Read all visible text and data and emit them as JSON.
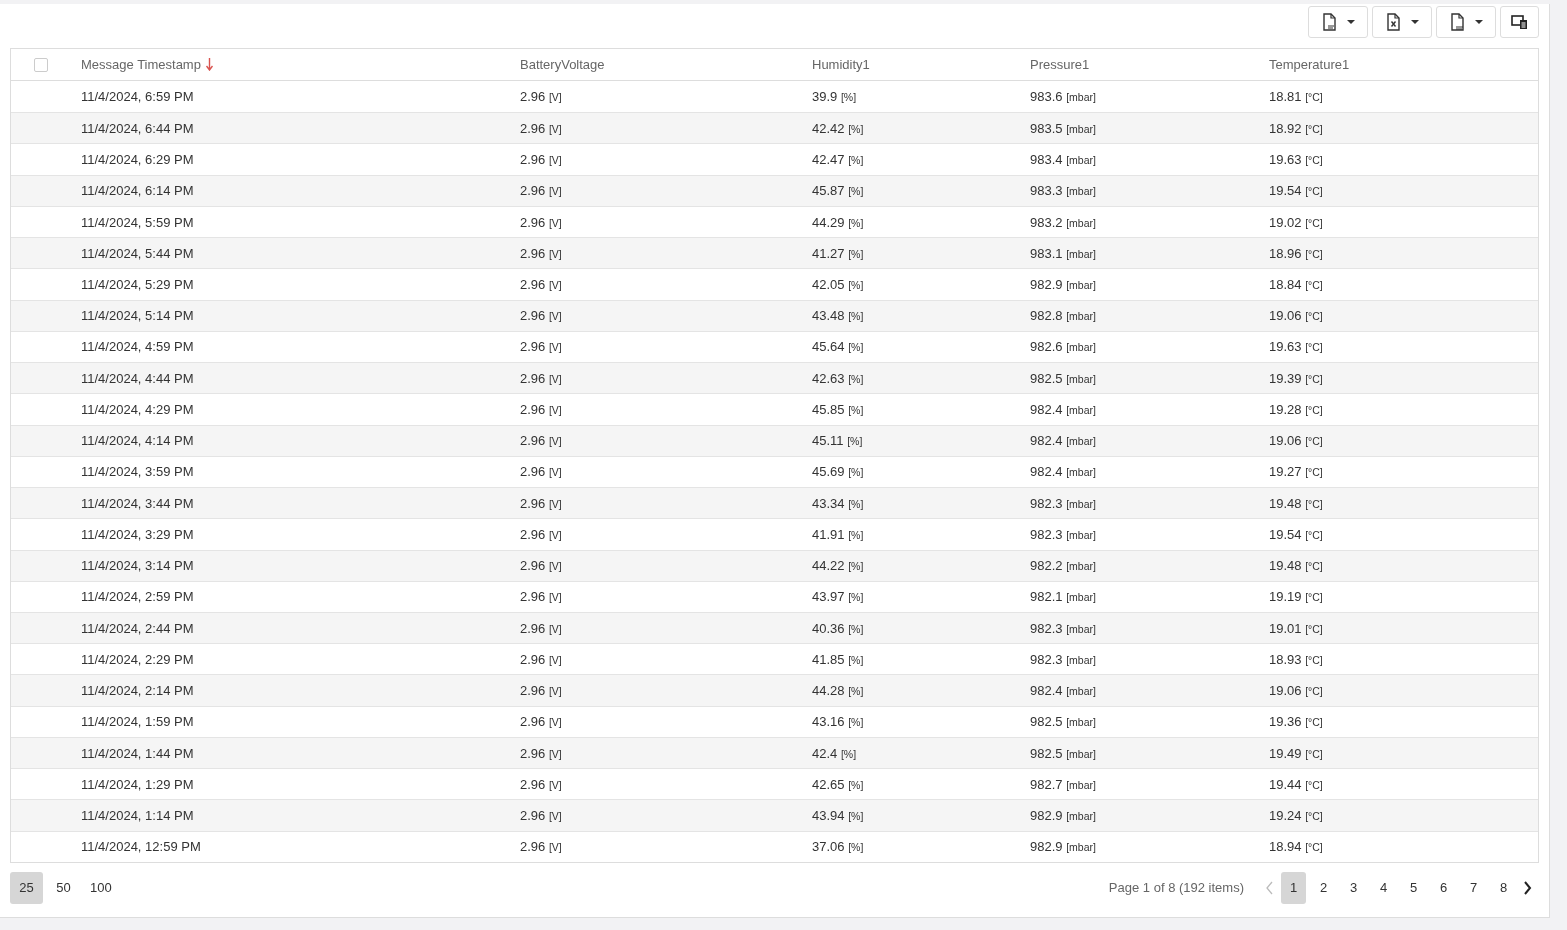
{
  "toolbar": [
    {
      "kind": "pdf",
      "dropdown": true
    },
    {
      "kind": "excel",
      "dropdown": true
    },
    {
      "kind": "csv",
      "dropdown": true
    },
    {
      "kind": "columns",
      "dropdown": false
    }
  ],
  "table": {
    "select_all": {
      "checked": false
    },
    "columns": [
      {
        "label": "Message Timestamp",
        "sorted_descending": true
      },
      {
        "label": "BatteryVoltage",
        "sorted_descending": false
      },
      {
        "label": "Humidity1",
        "sorted_descending": false
      },
      {
        "label": "Pressure1",
        "sorted_descending": false
      },
      {
        "label": "Temperature1",
        "sorted_descending": false
      }
    ],
    "rows": [
      [
        "11/4/2024, 6:59 PM",
        [
          "2.96",
          "[V]"
        ],
        [
          "39.9",
          "[%]"
        ],
        [
          "983.6",
          "[mbar]"
        ],
        [
          "18.81",
          "[°C]"
        ]
      ],
      [
        "11/4/2024, 6:44 PM",
        [
          "2.96",
          "[V]"
        ],
        [
          "42.42",
          "[%]"
        ],
        [
          "983.5",
          "[mbar]"
        ],
        [
          "18.92",
          "[°C]"
        ]
      ],
      [
        "11/4/2024, 6:29 PM",
        [
          "2.96",
          "[V]"
        ],
        [
          "42.47",
          "[%]"
        ],
        [
          "983.4",
          "[mbar]"
        ],
        [
          "19.63",
          "[°C]"
        ]
      ],
      [
        "11/4/2024, 6:14 PM",
        [
          "2.96",
          "[V]"
        ],
        [
          "45.87",
          "[%]"
        ],
        [
          "983.3",
          "[mbar]"
        ],
        [
          "19.54",
          "[°C]"
        ]
      ],
      [
        "11/4/2024, 5:59 PM",
        [
          "2.96",
          "[V]"
        ],
        [
          "44.29",
          "[%]"
        ],
        [
          "983.2",
          "[mbar]"
        ],
        [
          "19.02",
          "[°C]"
        ]
      ],
      [
        "11/4/2024, 5:44 PM",
        [
          "2.96",
          "[V]"
        ],
        [
          "41.27",
          "[%]"
        ],
        [
          "983.1",
          "[mbar]"
        ],
        [
          "18.96",
          "[°C]"
        ]
      ],
      [
        "11/4/2024, 5:29 PM",
        [
          "2.96",
          "[V]"
        ],
        [
          "42.05",
          "[%]"
        ],
        [
          "982.9",
          "[mbar]"
        ],
        [
          "18.84",
          "[°C]"
        ]
      ],
      [
        "11/4/2024, 5:14 PM",
        [
          "2.96",
          "[V]"
        ],
        [
          "43.48",
          "[%]"
        ],
        [
          "982.8",
          "[mbar]"
        ],
        [
          "19.06",
          "[°C]"
        ]
      ],
      [
        "11/4/2024, 4:59 PM",
        [
          "2.96",
          "[V]"
        ],
        [
          "45.64",
          "[%]"
        ],
        [
          "982.6",
          "[mbar]"
        ],
        [
          "19.63",
          "[°C]"
        ]
      ],
      [
        "11/4/2024, 4:44 PM",
        [
          "2.96",
          "[V]"
        ],
        [
          "42.63",
          "[%]"
        ],
        [
          "982.5",
          "[mbar]"
        ],
        [
          "19.39",
          "[°C]"
        ]
      ],
      [
        "11/4/2024, 4:29 PM",
        [
          "2.96",
          "[V]"
        ],
        [
          "45.85",
          "[%]"
        ],
        [
          "982.4",
          "[mbar]"
        ],
        [
          "19.28",
          "[°C]"
        ]
      ],
      [
        "11/4/2024, 4:14 PM",
        [
          "2.96",
          "[V]"
        ],
        [
          "45.11",
          "[%]"
        ],
        [
          "982.4",
          "[mbar]"
        ],
        [
          "19.06",
          "[°C]"
        ]
      ],
      [
        "11/4/2024, 3:59 PM",
        [
          "2.96",
          "[V]"
        ],
        [
          "45.69",
          "[%]"
        ],
        [
          "982.4",
          "[mbar]"
        ],
        [
          "19.27",
          "[°C]"
        ]
      ],
      [
        "11/4/2024, 3:44 PM",
        [
          "2.96",
          "[V]"
        ],
        [
          "43.34",
          "[%]"
        ],
        [
          "982.3",
          "[mbar]"
        ],
        [
          "19.48",
          "[°C]"
        ]
      ],
      [
        "11/4/2024, 3:29 PM",
        [
          "2.96",
          "[V]"
        ],
        [
          "41.91",
          "[%]"
        ],
        [
          "982.3",
          "[mbar]"
        ],
        [
          "19.54",
          "[°C]"
        ]
      ],
      [
        "11/4/2024, 3:14 PM",
        [
          "2.96",
          "[V]"
        ],
        [
          "44.22",
          "[%]"
        ],
        [
          "982.2",
          "[mbar]"
        ],
        [
          "19.48",
          "[°C]"
        ]
      ],
      [
        "11/4/2024, 2:59 PM",
        [
          "2.96",
          "[V]"
        ],
        [
          "43.97",
          "[%]"
        ],
        [
          "982.1",
          "[mbar]"
        ],
        [
          "19.19",
          "[°C]"
        ]
      ],
      [
        "11/4/2024, 2:44 PM",
        [
          "2.96",
          "[V]"
        ],
        [
          "40.36",
          "[%]"
        ],
        [
          "982.3",
          "[mbar]"
        ],
        [
          "19.01",
          "[°C]"
        ]
      ],
      [
        "11/4/2024, 2:29 PM",
        [
          "2.96",
          "[V]"
        ],
        [
          "41.85",
          "[%]"
        ],
        [
          "982.3",
          "[mbar]"
        ],
        [
          "18.93",
          "[°C]"
        ]
      ],
      [
        "11/4/2024, 2:14 PM",
        [
          "2.96",
          "[V]"
        ],
        [
          "44.28",
          "[%]"
        ],
        [
          "982.4",
          "[mbar]"
        ],
        [
          "19.06",
          "[°C]"
        ]
      ],
      [
        "11/4/2024, 1:59 PM",
        [
          "2.96",
          "[V]"
        ],
        [
          "43.16",
          "[%]"
        ],
        [
          "982.5",
          "[mbar]"
        ],
        [
          "19.36",
          "[°C]"
        ]
      ],
      [
        "11/4/2024, 1:44 PM",
        [
          "2.96",
          "[V]"
        ],
        [
          "42.4",
          "[%]"
        ],
        [
          "982.5",
          "[mbar]"
        ],
        [
          "19.49",
          "[°C]"
        ]
      ],
      [
        "11/4/2024, 1:29 PM",
        [
          "2.96",
          "[V]"
        ],
        [
          "42.65",
          "[%]"
        ],
        [
          "982.7",
          "[mbar]"
        ],
        [
          "19.44",
          "[°C]"
        ]
      ],
      [
        "11/4/2024, 1:14 PM",
        [
          "2.96",
          "[V]"
        ],
        [
          "43.94",
          "[%]"
        ],
        [
          "982.9",
          "[mbar]"
        ],
        [
          "19.24",
          "[°C]"
        ]
      ],
      [
        "11/4/2024, 12:59 PM",
        [
          "2.96",
          "[V]"
        ],
        [
          "37.06",
          "[%]"
        ],
        [
          "982.9",
          "[mbar]"
        ],
        [
          "18.94",
          "[°C]"
        ]
      ]
    ]
  },
  "pager": {
    "page_sizes": [
      {
        "label": "25",
        "selected": true
      },
      {
        "label": "50",
        "selected": false
      },
      {
        "label": "100",
        "selected": false
      }
    ],
    "info": "Page 1 of 8 (192 items)",
    "prev": {
      "disabled": true
    },
    "next": {
      "disabled": false
    },
    "pages": [
      {
        "label": "1",
        "selected": true
      },
      {
        "label": "2",
        "selected": false
      },
      {
        "label": "3",
        "selected": false
      },
      {
        "label": "4",
        "selected": false
      },
      {
        "label": "5",
        "selected": false
      },
      {
        "label": "6",
        "selected": false
      },
      {
        "label": "7",
        "selected": false
      },
      {
        "label": "8",
        "selected": false
      }
    ]
  }
}
